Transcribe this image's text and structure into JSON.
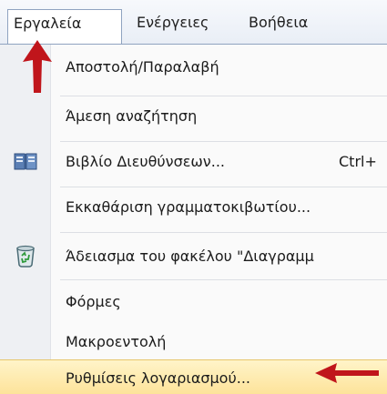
{
  "menubar": {
    "items": [
      {
        "label": "Εργαλεία"
      },
      {
        "label": "Ενέργειες"
      },
      {
        "label": "Βοήθεια"
      }
    ]
  },
  "dropdown": {
    "items": [
      {
        "label": "Αποστολή/Παραλαβή"
      },
      {
        "label": "Άμεση αναζήτηση"
      },
      {
        "label": "Βιβλίο Διευθύνσεων...",
        "shortcut": "Ctrl+"
      },
      {
        "label": "Εκκαθάριση γραμματοκιβωτίου..."
      },
      {
        "label": "Άδειασμα του φακέλου \"Διαγραμμ"
      },
      {
        "label": "Φόρμες"
      },
      {
        "label": "Μακροεντολή"
      },
      {
        "label": "Ρυθμίσεις λογαριασμού..."
      }
    ]
  },
  "icons": {
    "address_book": "address-book-icon",
    "empty_folder": "recycle-bin-icon"
  },
  "colors": {
    "arrow": "#c0151b",
    "highlight": "#fde39a"
  }
}
